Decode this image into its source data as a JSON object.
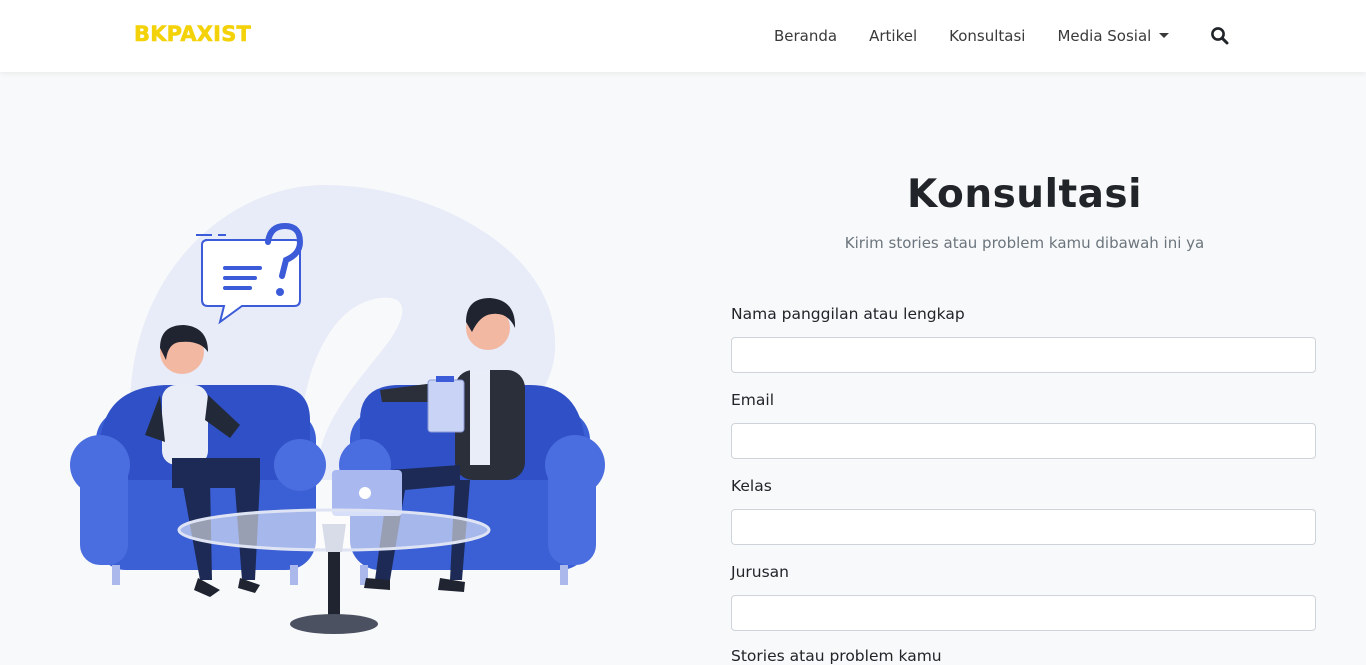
{
  "navbar": {
    "brand": "BKPAXIST",
    "links": [
      {
        "label": "Beranda"
      },
      {
        "label": "Artikel"
      },
      {
        "label": "Konsultasi"
      },
      {
        "label": "Media Sosial"
      }
    ],
    "search_icon": "search-icon"
  },
  "hero": {
    "title": "Konsultasi",
    "subtitle": "Kirim stories atau problem kamu dibawah ini ya"
  },
  "form": {
    "fields": [
      {
        "label": "Nama panggilan atau lengkap",
        "value": ""
      },
      {
        "label": "Email",
        "value": ""
      },
      {
        "label": "Kelas",
        "value": ""
      },
      {
        "label": "Jurusan",
        "value": ""
      },
      {
        "label": "Stories atau problem kamu",
        "value": ""
      }
    ]
  },
  "colors": {
    "brand": "#f4d20a",
    "illustration_blue": "#3c5fd6",
    "background": "#f8f9fa"
  }
}
